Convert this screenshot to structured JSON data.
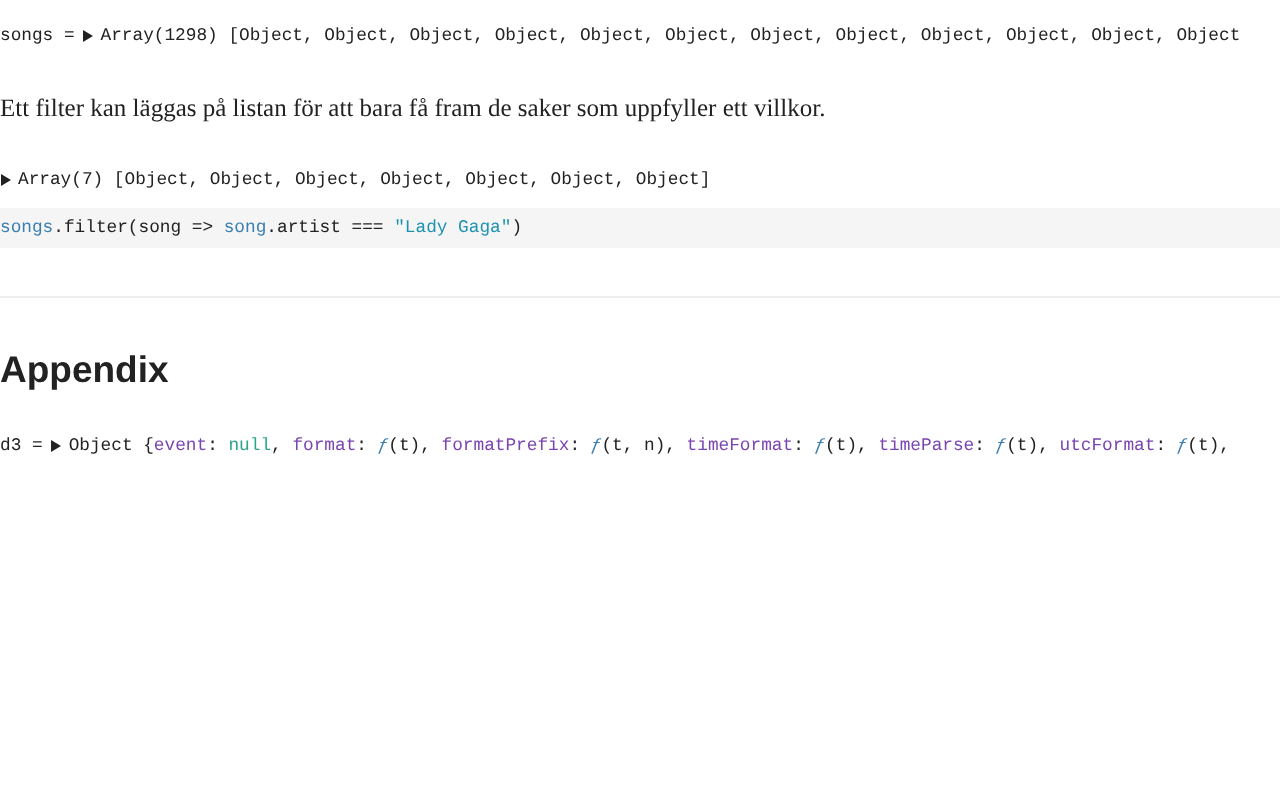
{
  "cells": [
    {
      "kind": "inspector",
      "name": "songs =",
      "expanded": false,
      "tokens": [
        {
          "text": "Array(1298) [Object, Object, Object, Object, Object, Object, Object, Object, Object, Object, Object, Object",
          "kind": "plain"
        }
      ]
    },
    {
      "kind": "prose",
      "text": "Ett filter kan läggas på listan för att bara få fram de saker som uppfyller ett villkor."
    },
    {
      "kind": "inspector",
      "expanded": false,
      "tokens": [
        {
          "text": "Array(7) [Object, Object, Object, Object, Object, Object, Object]",
          "kind": "plain"
        }
      ]
    },
    {
      "kind": "code",
      "tokens": [
        {
          "text": "songs",
          "kind": "variable"
        },
        {
          "text": ".filter(song => ",
          "kind": "plain"
        },
        {
          "text": "song",
          "kind": "variable"
        },
        {
          "text": ".artist === ",
          "kind": "plain"
        },
        {
          "text": "\"Lady Gaga\"",
          "kind": "string"
        },
        {
          "text": ")",
          "kind": "plain"
        }
      ]
    },
    {
      "kind": "rule"
    },
    {
      "kind": "heading",
      "text": "Appendix"
    },
    {
      "kind": "inspector",
      "name": "d3 =",
      "expanded": false,
      "tokens": [
        {
          "text": "Object {",
          "kind": "plain"
        },
        {
          "text": "event",
          "kind": "key"
        },
        {
          "text": ": ",
          "kind": "plain"
        },
        {
          "text": "null",
          "kind": "null"
        },
        {
          "text": ", ",
          "kind": "plain"
        },
        {
          "text": "format",
          "kind": "key"
        },
        {
          "text": ": ",
          "kind": "plain"
        },
        {
          "text": "ƒ",
          "kind": "function"
        },
        {
          "text": "(t), ",
          "kind": "plain"
        },
        {
          "text": "formatPrefix",
          "kind": "key"
        },
        {
          "text": ": ",
          "kind": "plain"
        },
        {
          "text": "ƒ",
          "kind": "function"
        },
        {
          "text": "(t, n), ",
          "kind": "plain"
        },
        {
          "text": "timeFormat",
          "kind": "key"
        },
        {
          "text": ": ",
          "kind": "plain"
        },
        {
          "text": "ƒ",
          "kind": "function"
        },
        {
          "text": "(t), ",
          "kind": "plain"
        },
        {
          "text": "timeParse",
          "kind": "key"
        },
        {
          "text": ": ",
          "kind": "plain"
        },
        {
          "text": "ƒ",
          "kind": "function"
        },
        {
          "text": "(t), ",
          "kind": "plain"
        },
        {
          "text": "utcFormat",
          "kind": "key"
        },
        {
          "text": ": ",
          "kind": "plain"
        },
        {
          "text": "ƒ",
          "kind": "function"
        },
        {
          "text": "(t),",
          "kind": "plain"
        }
      ]
    }
  ]
}
